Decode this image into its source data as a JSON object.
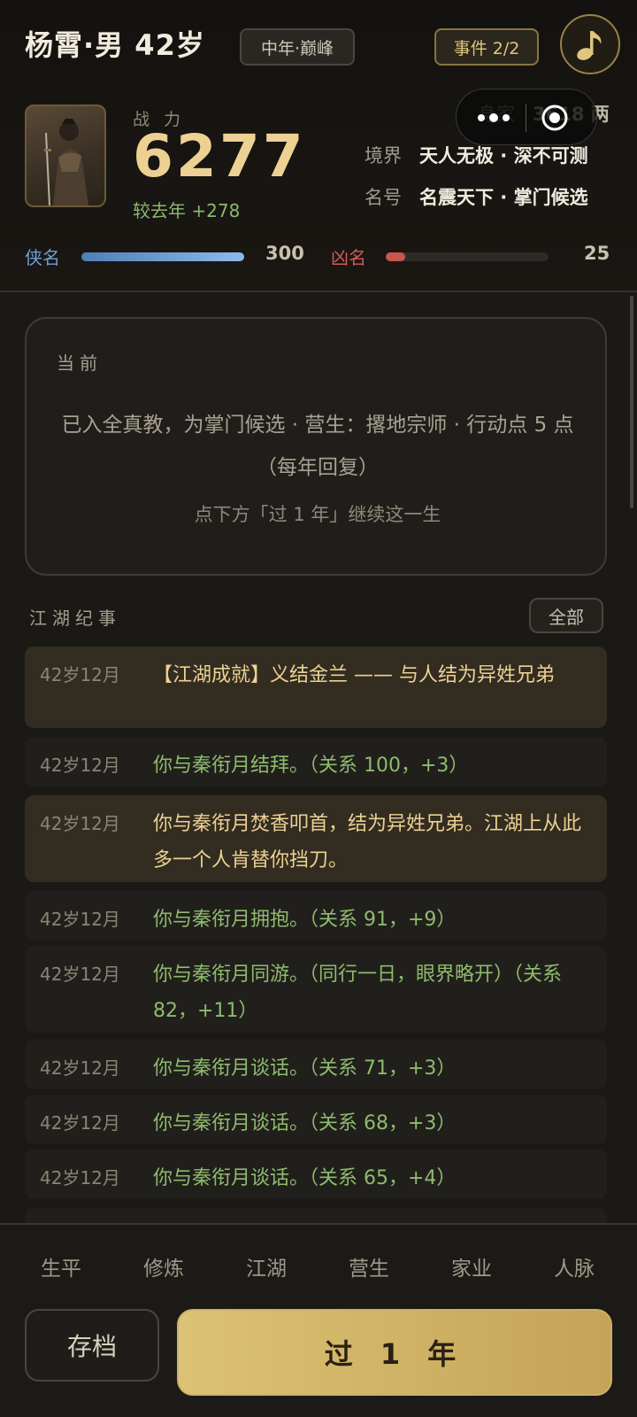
{
  "header": {
    "name": "杨霄·男 42岁",
    "age_tag": "中年·巅峰",
    "event_btn": "事件 2/2",
    "music_icon": "music-note-icon"
  },
  "stats": {
    "power_label": "战力",
    "power_value": "6277",
    "power_delta": "较去年 +278",
    "wealth_key": "身家",
    "wealth_value": "3618 两",
    "realm_key": "境界",
    "realm_value": "天人无极 · 深不可测",
    "title_key": "名号",
    "title_value": "名震天下 · 掌门候选"
  },
  "reputation": {
    "good_label": "侠名",
    "good_value": "300",
    "good_fill": 1.0,
    "evil_label": "凶名",
    "evil_value": "25",
    "evil_fill": 0.12,
    "good_color": "#6e9fd6",
    "evil_color": "#d25a55"
  },
  "current": {
    "title": "当前",
    "text": "已入全真教，为掌门候选 · 营生：撂地宗师 · 行动点 5 点（每年回复）",
    "hint": "点下方「过 1 年」继续这一生"
  },
  "log": {
    "title": "江湖纪事",
    "all_btn": "全部",
    "items": [
      {
        "date": "42岁12月",
        "text": "【江湖成就】义结金兰 —— 与人结为异姓兄弟"
      },
      {
        "date": "42岁12月",
        "text": "你与秦衔月结拜。（关系 100，+3）"
      },
      {
        "date": "42岁12月",
        "text": "你与秦衔月焚香叩首，结为异姓兄弟。江湖上从此多一个人肯替你挡刀。"
      },
      {
        "date": "42岁12月",
        "text": "你与秦衔月拥抱。（关系 91，+9）"
      },
      {
        "date": "42岁12月",
        "text": "你与秦衔月同游。（同行一日，眼界略开）（关系 82，+11）"
      },
      {
        "date": "42岁12月",
        "text": "你与秦衔月谈话。（关系 71，+3）"
      },
      {
        "date": "42岁12月",
        "text": "你与秦衔月谈话。（关系 68，+3）"
      },
      {
        "date": "42岁12月",
        "text": "你与秦衔月谈话。（关系 65，+4）"
      }
    ]
  },
  "tabs": [
    "生平",
    "修炼",
    "江湖",
    "营生",
    "家业",
    "人脉"
  ],
  "actions": {
    "save": "存档",
    "next_year": "过 1 年"
  },
  "colors": {
    "gold": "#ecd193",
    "green": "#8dbb6e",
    "background": "#1b1915"
  }
}
